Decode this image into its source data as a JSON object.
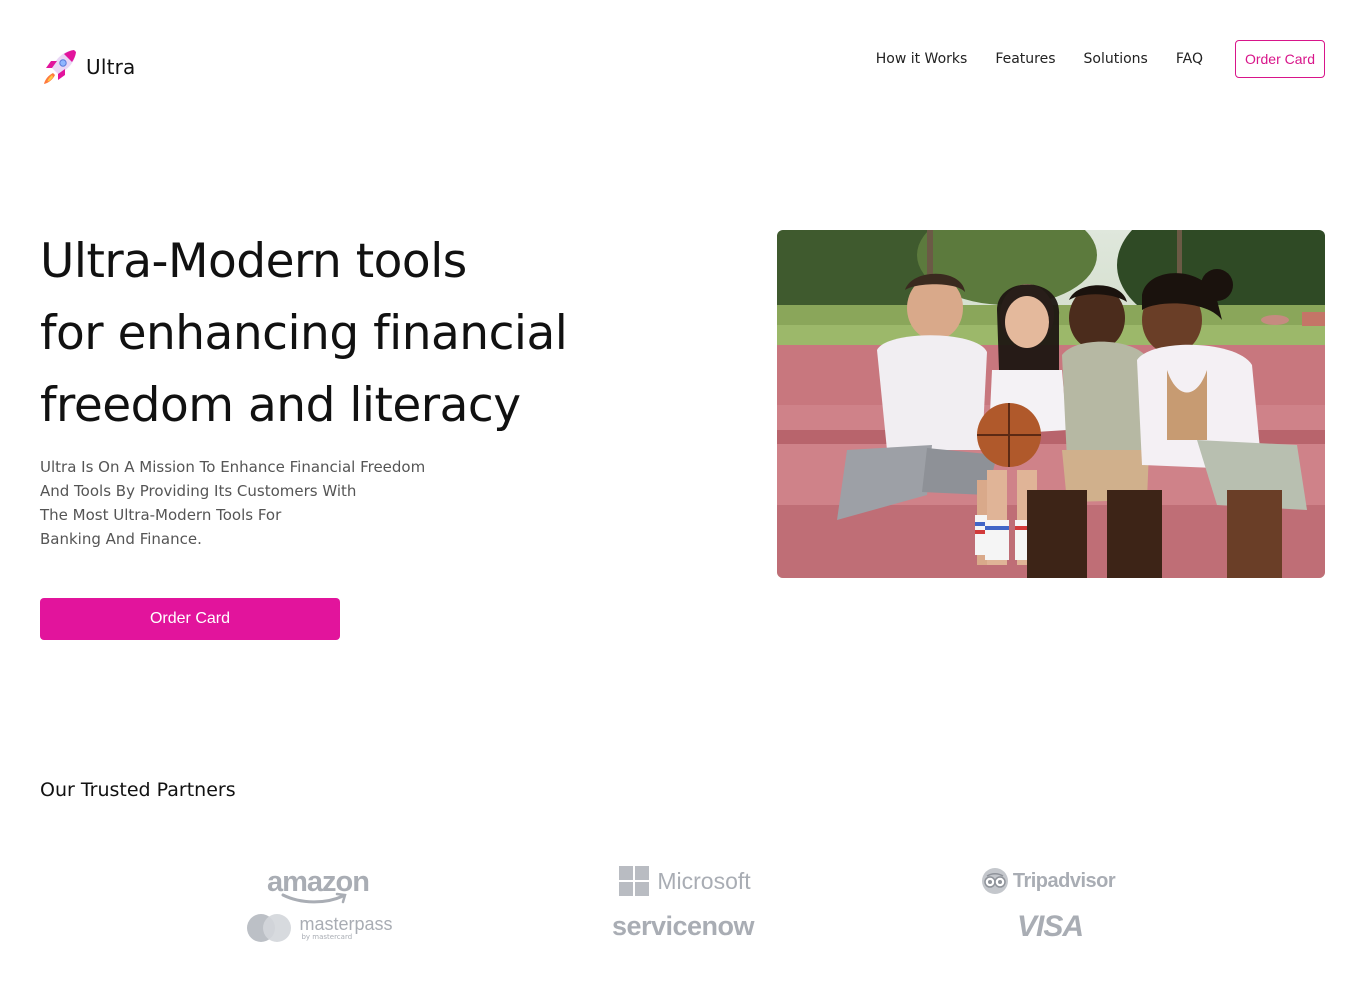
{
  "brand": {
    "name": "Ultra"
  },
  "nav": {
    "links": [
      "How it Works",
      "Features",
      "Solutions",
      "FAQ"
    ],
    "cta": "Order Card"
  },
  "hero": {
    "title_lines": [
      "Ultra-Modern tools",
      "for enhancing financial",
      "freedom and literacy"
    ],
    "description_lines": [
      "Ultra Is On A Mission To Enhance Financial Freedom",
      "And Tools By Providing Its Customers With",
      "The Most Ultra-Modern Tools For",
      "Banking And Finance."
    ],
    "cta": "Order Card"
  },
  "partners": {
    "title": "Our Trusted Partners",
    "logos": {
      "amazon": "amazon",
      "microsoft": "Microsoft",
      "tripadvisor": "Tripadvisor",
      "masterpass": "masterpass",
      "masterpass_sub": "by mastercard",
      "servicenow": "servicenow",
      "visa": "VISA"
    }
  },
  "colors": {
    "accent": "#e2149c",
    "accent_outline": "#d8158a",
    "logo_gray": "#a9adb4"
  }
}
